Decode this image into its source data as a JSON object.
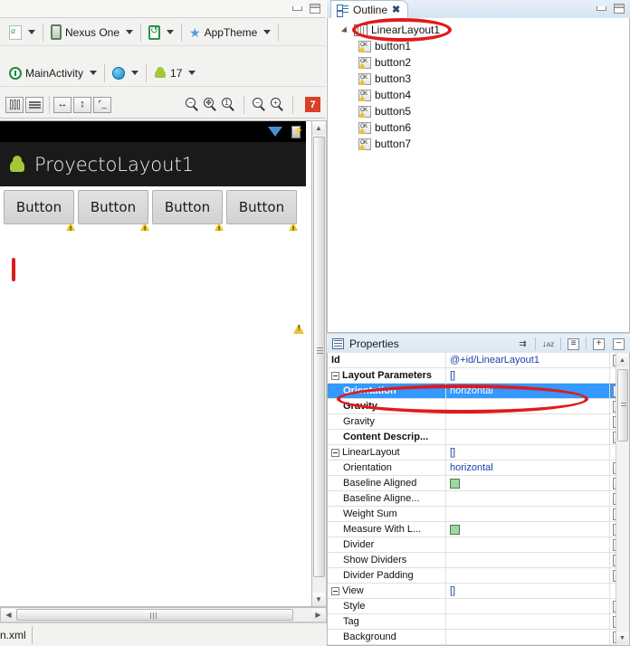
{
  "window": {
    "left_panel": {
      "minimize_label": "Minimize",
      "maximize_label": "Maximize"
    },
    "right_panel": {
      "minimize_label": "Minimize",
      "maximize_label": "Maximize"
    }
  },
  "editor_toolbar": {
    "row1": {
      "config_icon": "xml-config-icon",
      "device": {
        "icon": "device-icon",
        "label": "Nexus One"
      },
      "orientation": {
        "icon": "rotate-icon"
      },
      "theme": {
        "icon": "star-icon",
        "label": "AppTheme"
      }
    },
    "row2": {
      "activity": {
        "icon": "activity-icon",
        "label": "MainActivity"
      },
      "locale": {
        "icon": "globe-icon"
      },
      "api": {
        "icon": "android-icon",
        "label": "17"
      }
    },
    "row3": {
      "layout_vertical_icon": "columns-icon",
      "layout_horizontal_icon": "rows-icon",
      "toggle_width_icon": "arrow-horizontal-icon",
      "toggle_height_icon": "arrow-vertical-icon",
      "toggle_baseline_icon": "baseline-icon",
      "zoom_out_icon": "zoom-out-icon",
      "zoom_fit_icon": "zoom-fit-icon",
      "zoom_actual_icon": "zoom-actual-icon",
      "zoom_minus_icon": "minus-icon",
      "zoom_plus_icon": "plus-icon",
      "error_count": "7"
    }
  },
  "preview": {
    "app_title": "ProyectoLayout1",
    "app_icon": "android-robot-icon",
    "statusbar": {
      "wifi_icon": "wifi-icon",
      "battery_icon": "battery-icon"
    },
    "buttons": [
      {
        "label": "Button",
        "warning_icon": "warning-icon"
      },
      {
        "label": "Button",
        "warning_icon": "warning-icon"
      },
      {
        "label": "Button",
        "warning_icon": "warning-icon"
      },
      {
        "label": "Button",
        "warning_icon": "warning-icon"
      }
    ],
    "canvas_warning_icon": "warning-icon"
  },
  "editor_tab": {
    "label": "n.xml"
  },
  "outline": {
    "tab_label": "Outline",
    "tab_icon": "outline-icon",
    "close_icon": "close-icon",
    "root": {
      "label": "LinearLayout1",
      "icon": "linearlayout-horizontal-icon",
      "expanded": true
    },
    "children": [
      {
        "label": "button1",
        "icon": "button-widget-icon"
      },
      {
        "label": "button2",
        "icon": "button-widget-icon"
      },
      {
        "label": "button3",
        "icon": "button-widget-icon"
      },
      {
        "label": "button4",
        "icon": "button-widget-icon"
      },
      {
        "label": "button5",
        "icon": "button-widget-icon"
      },
      {
        "label": "button6",
        "icon": "button-widget-icon"
      },
      {
        "label": "button7",
        "icon": "button-widget-icon"
      }
    ]
  },
  "properties": {
    "title": "Properties",
    "title_icon": "properties-icon",
    "toolbar": {
      "show_advanced_icon": "show-advanced-icon",
      "sort_alpha_icon": "sort-alphabetical-icon",
      "default_properties_icon": "default-properties-icon",
      "expand_all_icon": "expand-all-icon",
      "collapse_all_icon": "collapse-all-icon"
    },
    "rows": [
      {
        "name": "Id",
        "value": "@+id/LinearLayout1",
        "bold": true,
        "indent": 0,
        "toggle": "none",
        "dots": true,
        "selected": false,
        "check": false
      },
      {
        "name": "Layout Parameters",
        "value": "[]",
        "bold": true,
        "indent": 0,
        "toggle": "minus",
        "dots": false,
        "selected": false,
        "check": false
      },
      {
        "name": "Orientation",
        "value": "horizontal",
        "bold": true,
        "indent": 1,
        "toggle": "none",
        "dots": true,
        "selected": true,
        "check": false
      },
      {
        "name": "Gravity",
        "value": "",
        "bold": true,
        "indent": 1,
        "toggle": "none",
        "dots": true,
        "selected": false,
        "check": false
      },
      {
        "name": "Gravity",
        "value": "",
        "bold": false,
        "indent": 1,
        "toggle": "none",
        "dots": true,
        "selected": false,
        "check": false
      },
      {
        "name": "Content Descrip...",
        "value": "",
        "bold": true,
        "indent": 1,
        "toggle": "none",
        "dots": true,
        "selected": false,
        "check": false
      },
      {
        "name": "LinearLayout",
        "value": "[]",
        "bold": false,
        "indent": 0,
        "toggle": "minus",
        "dots": false,
        "selected": false,
        "check": false
      },
      {
        "name": "Orientation",
        "value": "horizontal",
        "bold": false,
        "indent": 1,
        "toggle": "none",
        "dots": true,
        "selected": false,
        "check": false
      },
      {
        "name": "Baseline Aligned",
        "value": "",
        "bold": false,
        "indent": 1,
        "toggle": "none",
        "dots": true,
        "selected": false,
        "check": true
      },
      {
        "name": "Baseline Aligne...",
        "value": "",
        "bold": false,
        "indent": 1,
        "toggle": "none",
        "dots": true,
        "selected": false,
        "check": false
      },
      {
        "name": "Weight Sum",
        "value": "",
        "bold": false,
        "indent": 1,
        "toggle": "none",
        "dots": true,
        "selected": false,
        "check": false
      },
      {
        "name": "Measure With L...",
        "value": "",
        "bold": false,
        "indent": 1,
        "toggle": "none",
        "dots": true,
        "selected": false,
        "check": true
      },
      {
        "name": "Divider",
        "value": "",
        "bold": false,
        "indent": 1,
        "toggle": "none",
        "dots": true,
        "selected": false,
        "check": false
      },
      {
        "name": "Show Dividers",
        "value": "",
        "bold": false,
        "indent": 1,
        "toggle": "none",
        "dots": true,
        "selected": false,
        "check": false
      },
      {
        "name": "Divider Padding",
        "value": "",
        "bold": false,
        "indent": 1,
        "toggle": "none",
        "dots": true,
        "selected": false,
        "check": false
      },
      {
        "name": "View",
        "value": "[]",
        "bold": false,
        "indent": 0,
        "toggle": "minus",
        "dots": false,
        "selected": false,
        "check": false
      },
      {
        "name": "Style",
        "value": "",
        "bold": false,
        "indent": 1,
        "toggle": "none",
        "dots": true,
        "selected": false,
        "check": false
      },
      {
        "name": "Tag",
        "value": "",
        "bold": false,
        "indent": 1,
        "toggle": "none",
        "dots": true,
        "selected": false,
        "check": false
      },
      {
        "name": "Background",
        "value": "",
        "bold": false,
        "indent": 1,
        "toggle": "none",
        "dots": true,
        "selected": false,
        "check": false
      }
    ]
  },
  "annotations": {
    "outline_highlight": "red-ellipse-around-linearlayout1",
    "orientation_highlight": "red-ellipse-around-orientation-row"
  },
  "colors": {
    "selection_blue": "#3399ff",
    "annotation_red": "#e01b1b",
    "error_badge_red": "#d8402a",
    "android_green": "#a4c639",
    "value_text_blue": "#1a3faa"
  }
}
